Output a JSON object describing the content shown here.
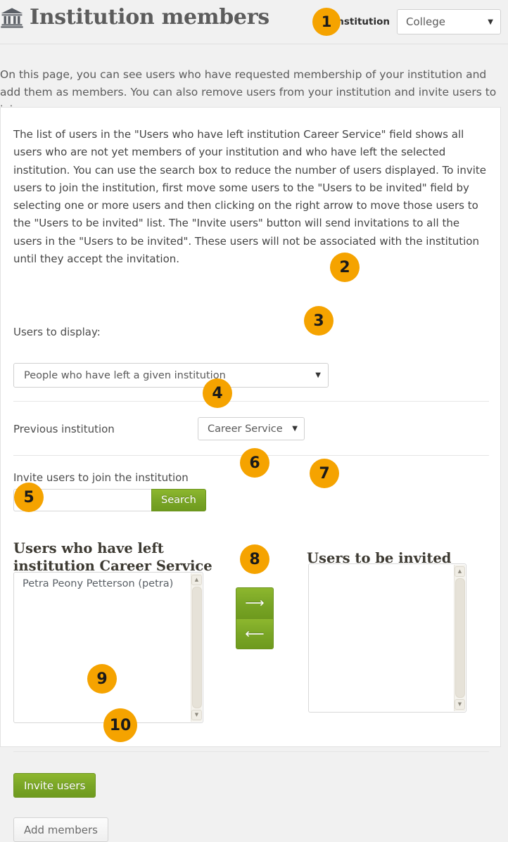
{
  "header": {
    "icon": "bank-institution-icon",
    "title": "Institution members",
    "institution_label": "Institution",
    "institution_value": "College",
    "caret": "▼"
  },
  "intro": "On this page, you can see users who have requested membership of your institution and add them as members. You can also remove users from your institution and invite users to join.",
  "panel": {
    "description": "The list of users in the \"Users who have left institution Career Service\" field shows all users who are not yet members of your institution and who have left the selected institution. You can use the search box to reduce the number of users displayed. To invite users to join the institution, first move some users to the \"Users to be invited\" field by selecting one or more users and then clicking on the right arrow to move those users to the \"Users to be invited\" list. The \"Invite users\" button will send invitations to all the users in the \"Users to be invited\". These users will not be associated with the institution until they accept the invitation.",
    "users_to_display_label": "Users to display:",
    "users_to_display_value": "People who have left a given institution",
    "previous_institution_label": "Previous institution",
    "previous_institution_value": "Career Service",
    "invite_label": "Invite users to join the institution",
    "search_value": "",
    "search_placeholder": "",
    "search_button": "Search",
    "left_heading": "Users who have left institution Career Service",
    "left_options": [
      "Petra Peony Petterson (petra)"
    ],
    "right_heading": "Users to be invited",
    "right_options": [],
    "arrow_right": "⟶",
    "arrow_left": "⟵",
    "invite_users_button": "Invite users",
    "add_members_button": "Add members",
    "scroll_up": "▲",
    "scroll_down": "▼"
  },
  "callouts": {
    "n1": "1",
    "n2": "2",
    "n3": "3",
    "n4": "4",
    "n5": "5",
    "n6": "6",
    "n7": "7",
    "n8": "8",
    "n9": "9",
    "n10": "10"
  },
  "colors": {
    "accent_orange": "#f5a300",
    "primary_green": "#7aa626",
    "page_bg": "#f1f1f1",
    "panel_bg": "#ffffff"
  }
}
